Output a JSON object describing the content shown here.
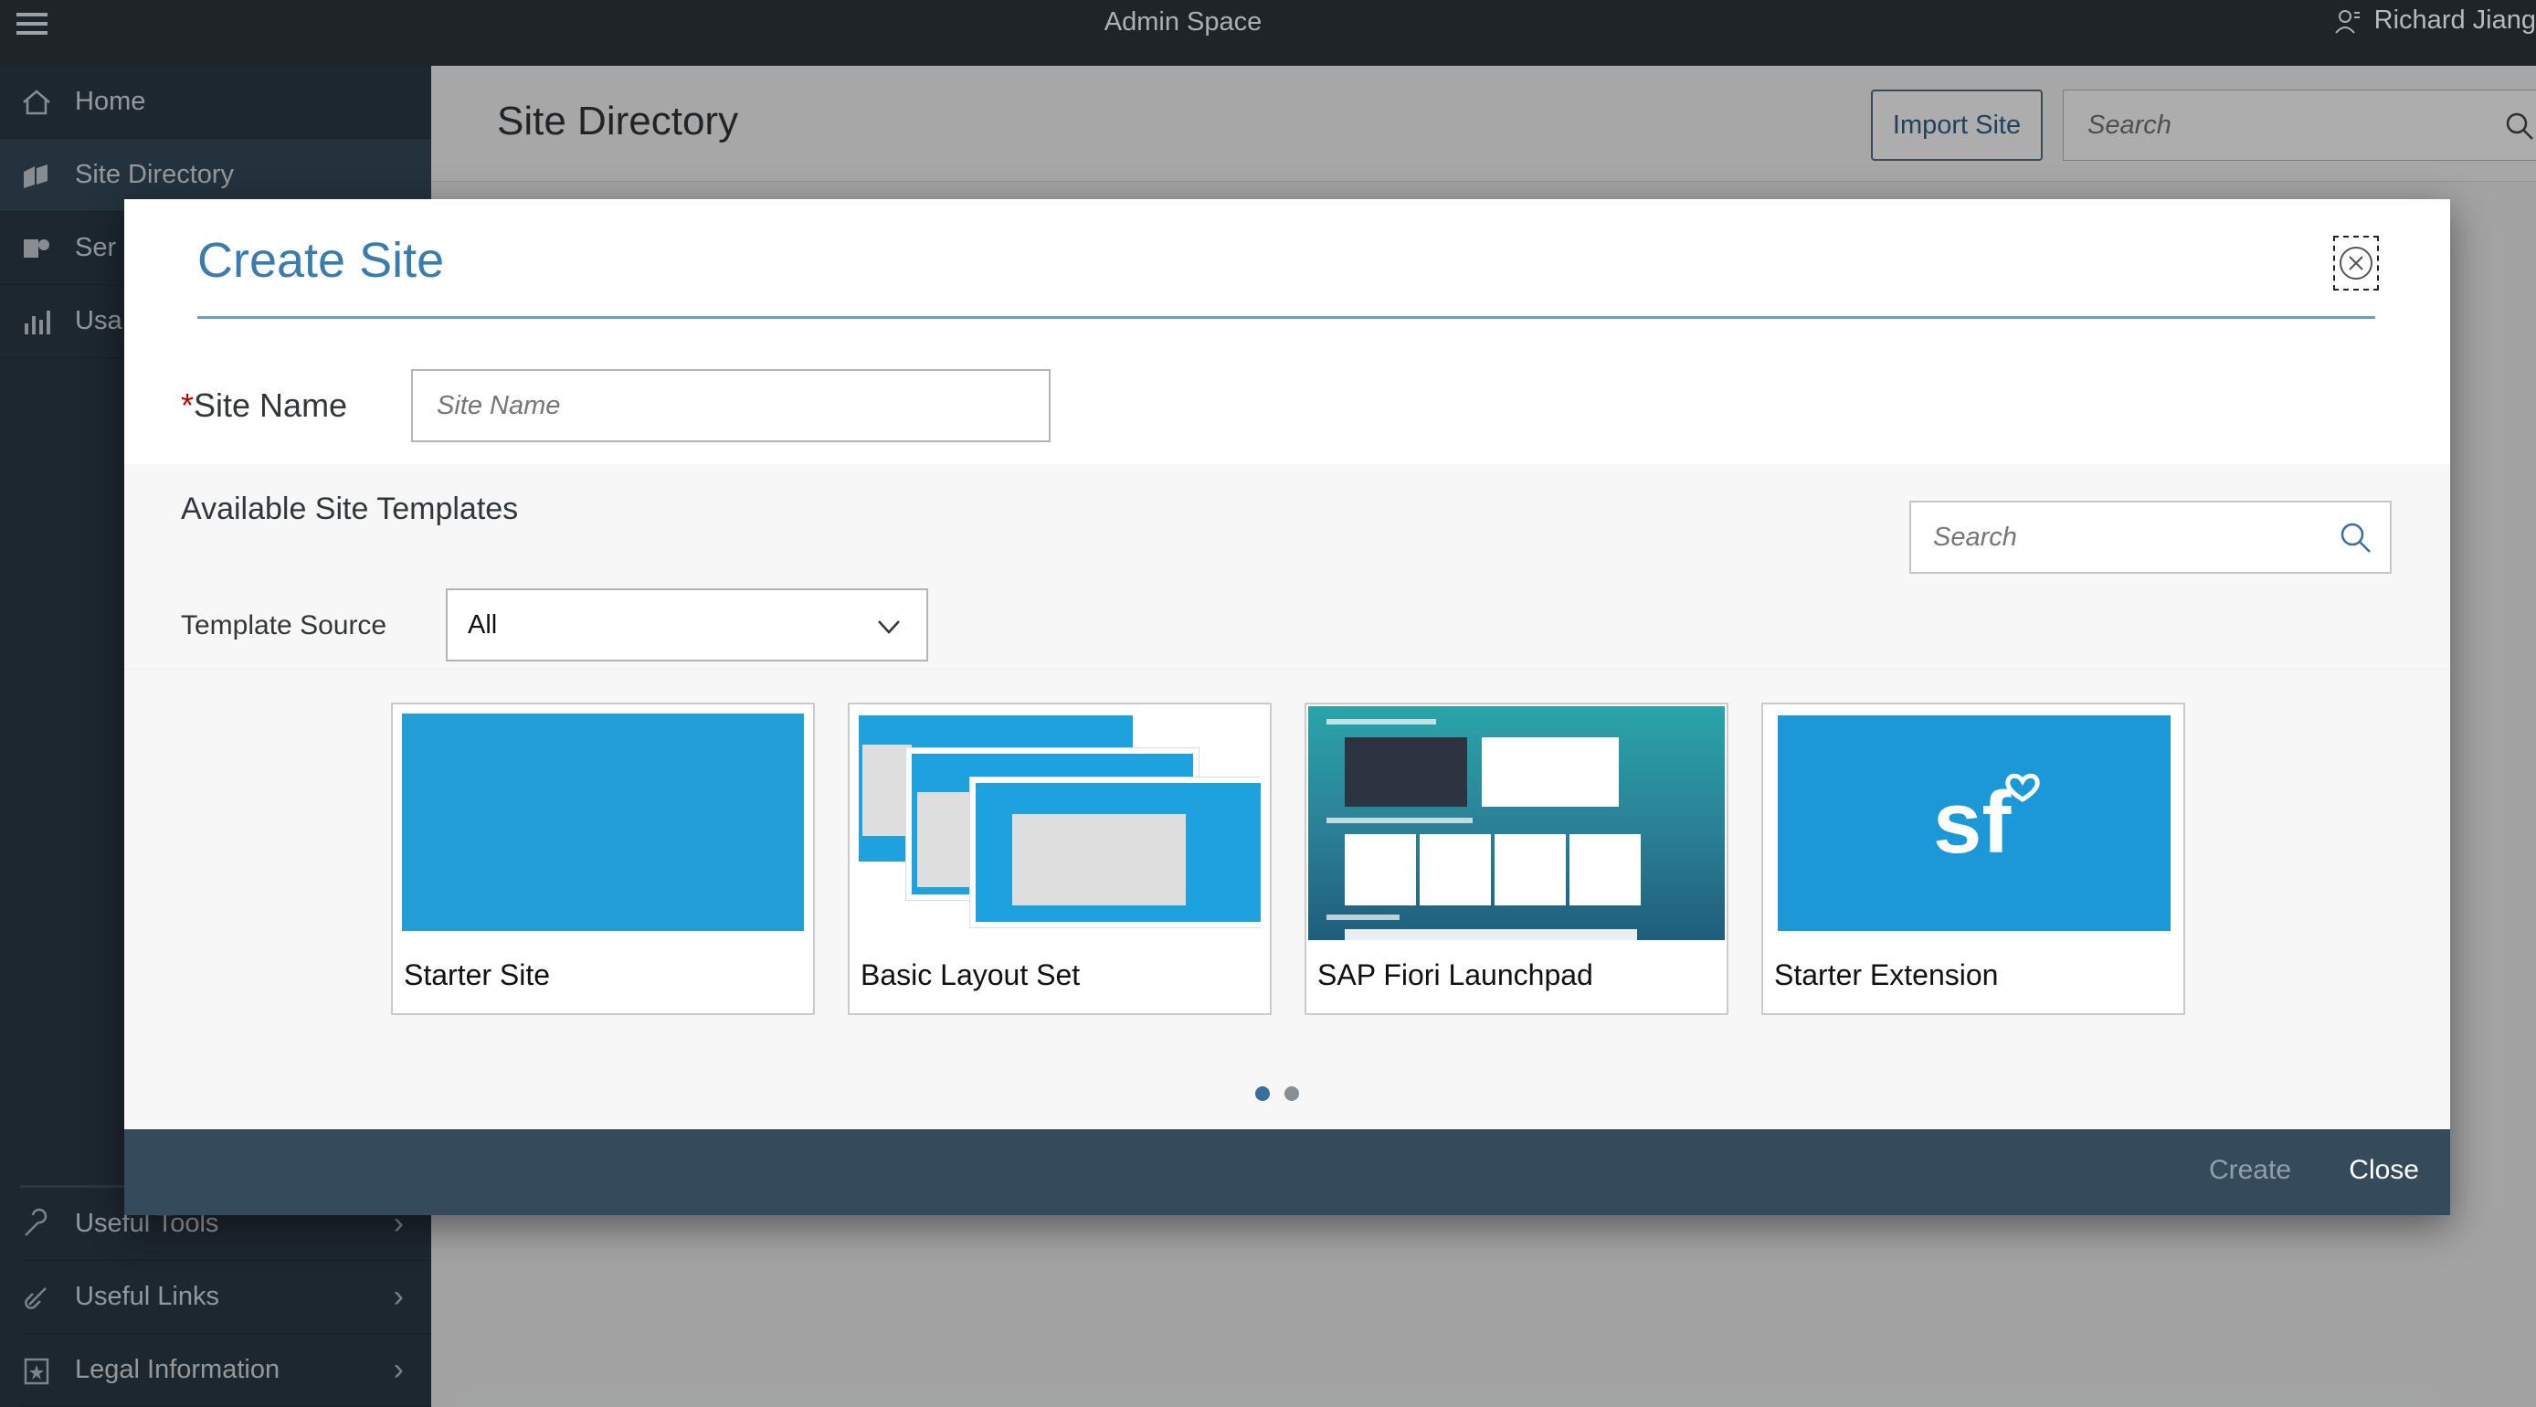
{
  "shell": {
    "title": "Admin Space",
    "user_name": "Richard Jiang"
  },
  "sidebar": {
    "items": [
      {
        "label": "Home",
        "icon": "home-icon"
      },
      {
        "label": "Site Directory",
        "icon": "site-directory-icon"
      },
      {
        "label": "Ser",
        "icon": "services-icon"
      },
      {
        "label": "Usa",
        "icon": "usage-icon"
      }
    ],
    "bottom_items": [
      {
        "label": "Useful Tools",
        "icon": "wrench-icon"
      },
      {
        "label": "Useful Links",
        "icon": "link-icon"
      },
      {
        "label": "Legal Information",
        "icon": "legal-icon"
      }
    ]
  },
  "main": {
    "page_title": "Site Directory",
    "import_button": "Import Site",
    "search_placeholder": "Search"
  },
  "dialog": {
    "title": "Create Site",
    "required_mark": "*",
    "site_name_label": "Site Name",
    "site_name_placeholder": "Site Name",
    "templates_heading": "Available Site Templates",
    "templates_search_placeholder": "Search",
    "template_source_label": "Template Source",
    "template_source_value": "All",
    "templates": [
      {
        "label": "Starter Site"
      },
      {
        "label": "Basic Layout Set"
      },
      {
        "label": "SAP Fiori Launchpad"
      },
      {
        "label": "Starter Extension"
      }
    ],
    "page_count": 2,
    "current_page": 1,
    "create_button": "Create",
    "close_button": "Close",
    "colors": {
      "accent": "#3a7cb0",
      "tile_blue": "#1ea1df",
      "footer": "#354a5a"
    }
  }
}
